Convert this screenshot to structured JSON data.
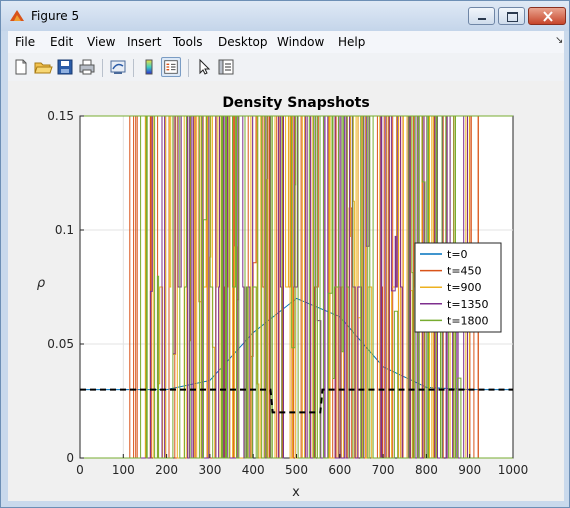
{
  "window": {
    "title": "Figure 5"
  },
  "menu": [
    "File",
    "Edit",
    "View",
    "Insert",
    "Tools",
    "Desktop",
    "Window",
    "Help"
  ],
  "toolbar": {
    "icons": [
      "new-file-icon",
      "open-folder-icon",
      "save-icon",
      "print-icon",
      "link-plot-icon",
      "colorbar-icon",
      "legend-icon",
      "pointer-icon",
      "property-editor-icon"
    ]
  },
  "chart_data": {
    "type": "line",
    "title": "Density Snapshots",
    "xlabel": "x",
    "ylabel": "ρ",
    "xlim": [
      0,
      1000
    ],
    "ylim": [
      0,
      0.15
    ],
    "xticks": [
      0,
      100,
      200,
      300,
      400,
      500,
      600,
      700,
      800,
      900,
      1000
    ],
    "yticks": [
      0,
      0.05,
      0.1,
      0.15
    ],
    "xtick_labels": [
      "0",
      "100",
      "200",
      "300",
      "400",
      "500",
      "600",
      "700",
      "800",
      "900",
      "1000"
    ],
    "ytick_labels": [
      "0",
      "0.05",
      "0.1",
      "0.15"
    ],
    "grid": true,
    "legend_position": "right",
    "series": [
      {
        "name": "t=0",
        "color": "#0072bd"
      },
      {
        "name": "t=450",
        "color": "#d95319"
      },
      {
        "name": "t=900",
        "color": "#edb120"
      },
      {
        "name": "t=1350",
        "color": "#7e2f8e"
      },
      {
        "name": "t=1800",
        "color": "#77ac30"
      }
    ],
    "reference": {
      "color": "#000000",
      "style": "dashed",
      "x": [
        0,
        440,
        445,
        450,
        550,
        555,
        560,
        1000
      ],
      "y": [
        0.03,
        0.03,
        0.02,
        0.02,
        0.02,
        0.02,
        0.03,
        0.03
      ]
    },
    "gaussian": {
      "x": [
        0,
        100,
        200,
        300,
        400,
        500,
        600,
        700,
        800,
        900,
        1000
      ],
      "y": [
        0.03,
        0.03,
        0.03,
        0.034,
        0.055,
        0.07,
        0.062,
        0.04,
        0.031,
        0.03,
        0.03
      ]
    },
    "envelope": {
      "x": [
        0,
        120,
        150,
        760,
        800,
        920,
        1000
      ],
      "y": [
        0,
        0,
        0.15,
        0.15,
        0.15,
        0,
        0
      ]
    }
  }
}
